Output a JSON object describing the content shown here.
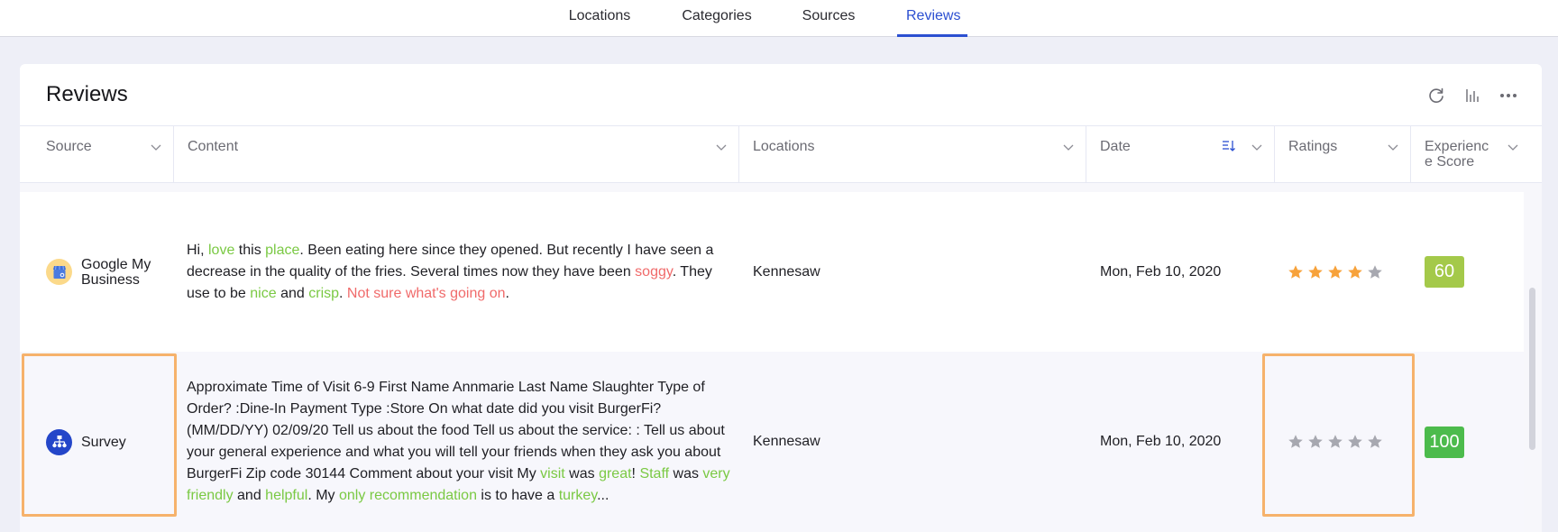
{
  "nav": {
    "tabs": [
      {
        "label": "Locations",
        "active": false
      },
      {
        "label": "Categories",
        "active": false
      },
      {
        "label": "Sources",
        "active": false
      },
      {
        "label": "Reviews",
        "active": true
      }
    ]
  },
  "card": {
    "title": "Reviews",
    "actions": [
      {
        "icon": "refresh-icon"
      },
      {
        "icon": "bar-chart-icon"
      },
      {
        "icon": "more-icon"
      }
    ]
  },
  "columns": [
    {
      "label": "Source"
    },
    {
      "label": "Content"
    },
    {
      "label": "Locations"
    },
    {
      "label": "Date",
      "sorted": "descending"
    },
    {
      "label": "Ratings"
    },
    {
      "label": "Experienc\ne Score"
    }
  ],
  "rows": [
    {
      "source": "Google My Business",
      "source_icon": "google-my-business-icon",
      "content_segments": [
        {
          "t": "Hi, ",
          "s": "n"
        },
        {
          "t": "love",
          "s": "g"
        },
        {
          "t": " this ",
          "s": "n"
        },
        {
          "t": "place",
          "s": "g"
        },
        {
          "t": ". Been eating here since they opened. But recently I have seen a decrease in the quality of the fries. Several times now they have been ",
          "s": "n"
        },
        {
          "t": "soggy",
          "s": "r"
        },
        {
          "t": ". They use to be ",
          "s": "n"
        },
        {
          "t": "nice",
          "s": "g"
        },
        {
          "t": " and ",
          "s": "n"
        },
        {
          "t": "crisp",
          "s": "g"
        },
        {
          "t": ". ",
          "s": "n"
        },
        {
          "t": "Not sure what's going on",
          "s": "r"
        },
        {
          "t": ".",
          "s": "n"
        }
      ],
      "location": "Kennesaw",
      "date": "Mon, Feb 10, 2020",
      "rating": 4,
      "rating_max": 5,
      "experience_score": "60",
      "score_color": "#a4c94a"
    },
    {
      "source": "Survey",
      "source_icon": "survey-icon",
      "content_segments": [
        {
          "t": "Approximate Time of Visit 6-9 First Name Annmarie Last Name Slaughter Type of Order? :Dine-In Payment Type :Store On what date did you visit BurgerFi? (MM/DD/YY) 02/09/20 Tell us about the food Tell us about the service: : Tell us about your general experience and what you will tell your friends when they ask you about BurgerFi Zip code 30144 Comment about your visit My ",
          "s": "n"
        },
        {
          "t": "visit",
          "s": "g"
        },
        {
          "t": " was ",
          "s": "n"
        },
        {
          "t": "great",
          "s": "g"
        },
        {
          "t": "! ",
          "s": "n"
        },
        {
          "t": "Staff",
          "s": "g"
        },
        {
          "t": " was ",
          "s": "n"
        },
        {
          "t": "very friendly",
          "s": "g"
        },
        {
          "t": " and ",
          "s": "n"
        },
        {
          "t": "helpful",
          "s": "g"
        },
        {
          "t": ". My ",
          "s": "n"
        },
        {
          "t": "only recommendation",
          "s": "g"
        },
        {
          "t": " is to have a ",
          "s": "n"
        },
        {
          "t": "turkey",
          "s": "g"
        },
        {
          "t": "...",
          "s": "n"
        }
      ],
      "location": "Kennesaw",
      "date": "Mon, Feb 10, 2020",
      "rating": 0,
      "rating_max": 5,
      "experience_score": "100",
      "score_color": "#4cbb4c"
    }
  ],
  "colors": {
    "accent": "#2b4fd1",
    "positive": "#7ac943",
    "negative": "#f06a6a",
    "star_filled": "#f7a23b",
    "star_empty": "#a7a8b0",
    "highlight": "#f6b26b"
  }
}
